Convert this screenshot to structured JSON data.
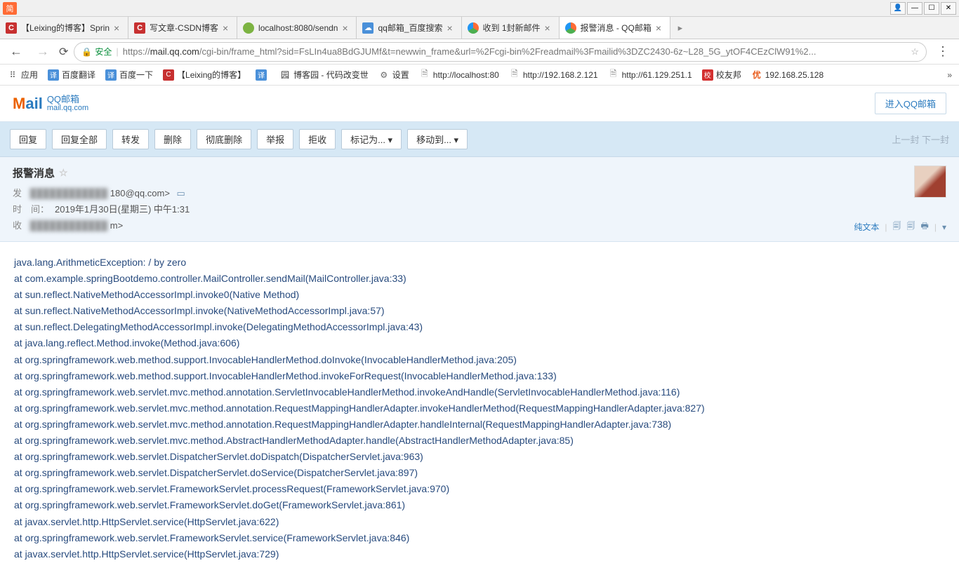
{
  "titlebar": {
    "left": "简"
  },
  "tabs": [
    {
      "title": "【Leixing的博客】Sprin",
      "favicon": "fi-c"
    },
    {
      "title": "写文章-CSDN博客",
      "favicon": "fi-c"
    },
    {
      "title": "localhost:8080/sendn",
      "favicon": "fi-green"
    },
    {
      "title": "qq邮箱_百度搜索",
      "favicon": "fi-blue"
    },
    {
      "title": "收到 1封新邮件",
      "favicon": "fi-tencent"
    },
    {
      "title": "报警消息 - QQ邮箱",
      "favicon": "fi-tencent",
      "active": true
    }
  ],
  "address": {
    "secure_label": "安全",
    "url_prefix": "https://",
    "url_host": "mail.qq.com",
    "url_path": "/cgi-bin/frame_html?sid=FsLIn4ua8BdGJUMf&t=newwin_frame&url=%2Fcgi-bin%2Freadmail%3Fmailid%3DZC2430-6z~L28_5G_ytOF4CEzClW91%2..."
  },
  "bookmarks": {
    "apps": "应用",
    "items": [
      {
        "icon": "译",
        "label": "百度翻译",
        "cls": "fi-blue"
      },
      {
        "icon": "译",
        "label": "百度一下",
        "cls": "fi-blue"
      },
      {
        "icon": "C",
        "label": "【Leixing的博客】",
        "cls": "fi-c"
      },
      {
        "icon": "译",
        "label": "",
        "cls": "fi-blue"
      },
      {
        "icon": "园",
        "label": "博客园 - 代码改变世",
        "cls": ""
      },
      {
        "icon": "⚙",
        "label": "设置",
        "cls": "fi-gear"
      },
      {
        "icon": "🗎",
        "label": "http://localhost:80",
        "cls": "fi-doc"
      },
      {
        "icon": "🗎",
        "label": "http://192.168.2.121",
        "cls": "fi-doc"
      },
      {
        "icon": "🗎",
        "label": "http://61.129.251.1",
        "cls": "fi-doc"
      },
      {
        "icon": "校",
        "label": "校友邦",
        "cls": "fi-red"
      },
      {
        "icon": "优",
        "label": "192.168.25.128",
        "cls": "fi-yi"
      }
    ]
  },
  "mail_header": {
    "logo_main": "Mail",
    "logo_sub": "QQ邮箱",
    "logo_domain": "mail.qq.com",
    "enter_btn": "进入QQ邮箱"
  },
  "actions": {
    "buttons": [
      "回复",
      "回复全部",
      "转发",
      "删除",
      "彻底删除",
      "举报",
      "拒收",
      "标记为... ▾",
      "移动到... ▾"
    ],
    "nav": "上一封 下一封"
  },
  "meta": {
    "subject": "报警消息",
    "from_label": "发",
    "from_value": "180@qq.com>",
    "time_label": "时　间：",
    "time_value": "2019年1月30日(星期三) 中午1:31",
    "to_label": "收",
    "to_value": "m>",
    "plain_text": "纯文本"
  },
  "body_lines": [
    "java.lang.ArithmeticException: / by zero",
    "at com.example.springBootdemo.controller.MailController.sendMail(MailController.java:33)",
    "at sun.reflect.NativeMethodAccessorImpl.invoke0(Native Method)",
    "at sun.reflect.NativeMethodAccessorImpl.invoke(NativeMethodAccessorImpl.java:57)",
    "at sun.reflect.DelegatingMethodAccessorImpl.invoke(DelegatingMethodAccessorImpl.java:43)",
    "at java.lang.reflect.Method.invoke(Method.java:606)",
    "at org.springframework.web.method.support.InvocableHandlerMethod.doInvoke(InvocableHandlerMethod.java:205)",
    "at org.springframework.web.method.support.InvocableHandlerMethod.invokeForRequest(InvocableHandlerMethod.java:133)",
    "at org.springframework.web.servlet.mvc.method.annotation.ServletInvocableHandlerMethod.invokeAndHandle(ServletInvocableHandlerMethod.java:116)",
    "at org.springframework.web.servlet.mvc.method.annotation.RequestMappingHandlerAdapter.invokeHandlerMethod(RequestMappingHandlerAdapter.java:827)",
    "at org.springframework.web.servlet.mvc.method.annotation.RequestMappingHandlerAdapter.handleInternal(RequestMappingHandlerAdapter.java:738)",
    "at org.springframework.web.servlet.mvc.method.AbstractHandlerMethodAdapter.handle(AbstractHandlerMethodAdapter.java:85)",
    "at org.springframework.web.servlet.DispatcherServlet.doDispatch(DispatcherServlet.java:963)",
    "at org.springframework.web.servlet.DispatcherServlet.doService(DispatcherServlet.java:897)",
    "at org.springframework.web.servlet.FrameworkServlet.processRequest(FrameworkServlet.java:970)",
    "at org.springframework.web.servlet.FrameworkServlet.doGet(FrameworkServlet.java:861)",
    "at javax.servlet.http.HttpServlet.service(HttpServlet.java:622)",
    "at org.springframework.web.servlet.FrameworkServlet.service(FrameworkServlet.java:846)",
    "at javax.servlet.http.HttpServlet.service(HttpServlet.java:729)"
  ]
}
